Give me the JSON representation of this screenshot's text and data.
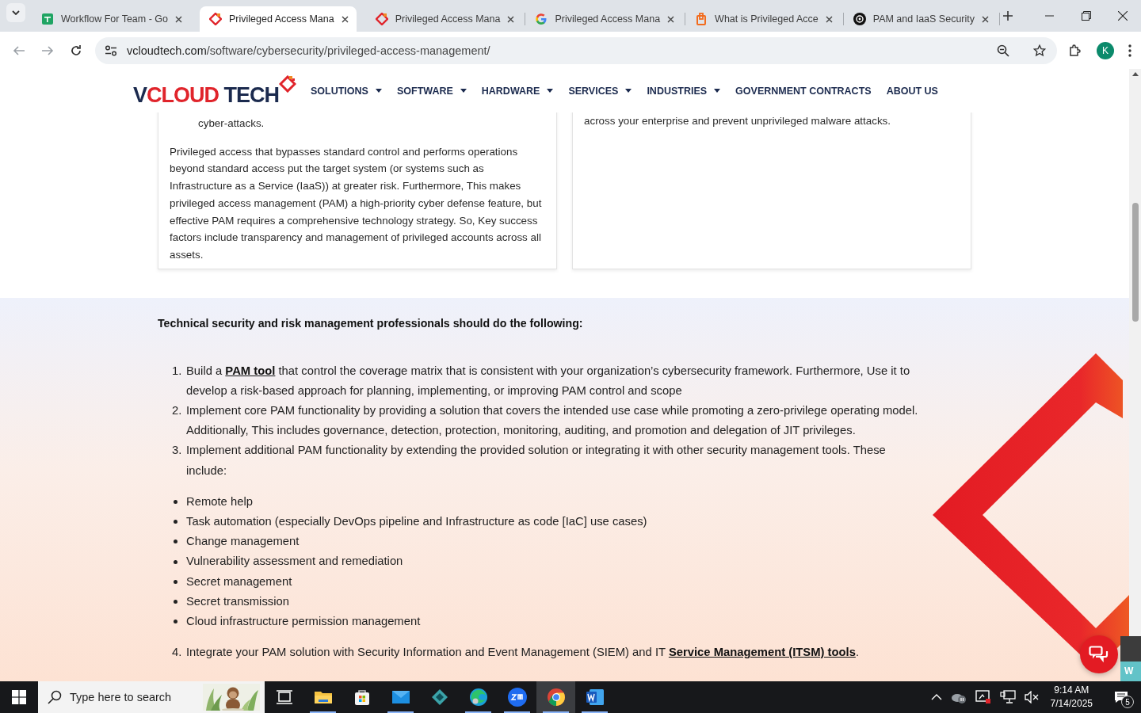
{
  "browser": {
    "tabs": [
      {
        "title": "Workflow For Team - Go",
        "kind": "sheets",
        "selected": false
      },
      {
        "title": "Privileged Access Mana",
        "kind": "vcloud",
        "selected": true
      },
      {
        "title": "Privileged Access Mana",
        "kind": "vcloud",
        "selected": false
      },
      {
        "title": "Privileged Access Mana",
        "kind": "google",
        "selected": false
      },
      {
        "title": "What is Privileged Acce",
        "kind": "orange",
        "selected": false
      },
      {
        "title": "PAM and IaaS Security",
        "kind": "openai",
        "selected": false
      }
    ],
    "url_host": "vcloudtech.com",
    "url_path": "/software/cybersecurity/privileged-access-management/",
    "profile": "K"
  },
  "site": {
    "logo": [
      {
        "text": "V",
        "color": "#1b2a4e"
      },
      {
        "text": "CLOUD",
        "color": "#e0242b"
      },
      {
        "text": " TECH",
        "color": "#1b2a4e"
      }
    ],
    "nav": [
      {
        "label": "SOLUTIONS",
        "dropdown": true
      },
      {
        "label": "SOFTWARE",
        "dropdown": true
      },
      {
        "label": "HARDWARE",
        "dropdown": true
      },
      {
        "label": "SERVICES",
        "dropdown": true
      },
      {
        "label": "INDUSTRIES",
        "dropdown": true
      },
      {
        "label": "GOVERNMENT CONTRACTS",
        "dropdown": false
      },
      {
        "label": "ABOUT US",
        "dropdown": false
      }
    ]
  },
  "cards": [
    {
      "bullet_tail": "cyber-attacks.",
      "paragraph": "Privileged access that bypasses standard control and performs operations beyond standard access put the target system (or systems such as Infrastructure as a Service (IaaS)) at greater risk. Furthermore, This makes privileged access management (PAM) a high-priority cyber defense feature, but effective PAM requires a comprehensive technology strategy. So, Key success factors include transparency and management of privileged accounts across all assets."
    },
    {
      "bullet_tail": "across your enterprise and prevent unprivileged malware attacks."
    }
  ],
  "section": {
    "heading": "Technical security and risk management professionals should do the following:",
    "steps": [
      {
        "number": "1.",
        "segments": [
          {
            "kind": "text",
            "text": "Build a "
          },
          {
            "kind": "link",
            "text": "PAM tool"
          },
          {
            "kind": "text",
            "text": " that control the coverage matrix that is consistent with your organization’s cybersecurity framework. Furthermore, Use it to develop a risk-based approach for planning, implementing, or improving PAM control and scope"
          }
        ]
      },
      {
        "number": "2.",
        "segments": [
          {
            "kind": "text",
            "text": "Implement core PAM functionality by providing a solution that covers the intended use case while promoting a zero-privilege operating model. Additionally, This includes governance, detection, protection, monitoring, auditing, and promotion and delegation of JIT privileges."
          }
        ]
      },
      {
        "number": "3.",
        "segments": [
          {
            "kind": "text",
            "text": "Implement additional PAM functionality by extending the provided solution or integrating it with other security management tools. These include:"
          }
        ]
      }
    ],
    "bullets": [
      "Remote help",
      "Task automation (especially DevOps pipeline and Infrastructure as code [IaC] use cases)",
      "Change management",
      "Vulnerability assessment and remediation",
      "Secret management",
      "Secret transmission",
      "Cloud infrastructure permission management"
    ],
    "final_steps": [
      {
        "number": "4.",
        "segments": [
          {
            "kind": "text",
            "text": "Integrate your PAM solution with Security Information and Event Management (SIEM) and IT "
          },
          {
            "kind": "link",
            "text": "Service Management (ITSM) tools"
          },
          {
            "kind": "text",
            "text": "."
          }
        ]
      }
    ],
    "widget_label": "W"
  },
  "taskbar": {
    "search_placeholder": "Type here to search",
    "apps": [
      {
        "kind": "taskview",
        "running": false,
        "active": false
      },
      {
        "kind": "explorer",
        "running": true,
        "active": false
      },
      {
        "kind": "store",
        "running": false,
        "active": false
      },
      {
        "kind": "mail",
        "running": true,
        "active": false
      },
      {
        "kind": "diamond",
        "running": false,
        "active": false
      },
      {
        "kind": "edge",
        "running": true,
        "active": false
      },
      {
        "kind": "zoom",
        "running": true,
        "active": false
      },
      {
        "kind": "chrome",
        "running": true,
        "active": true
      },
      {
        "kind": "word",
        "running": true,
        "active": false
      }
    ],
    "time": "9:14 AM",
    "date": "7/14/2025",
    "notifications": "5"
  }
}
